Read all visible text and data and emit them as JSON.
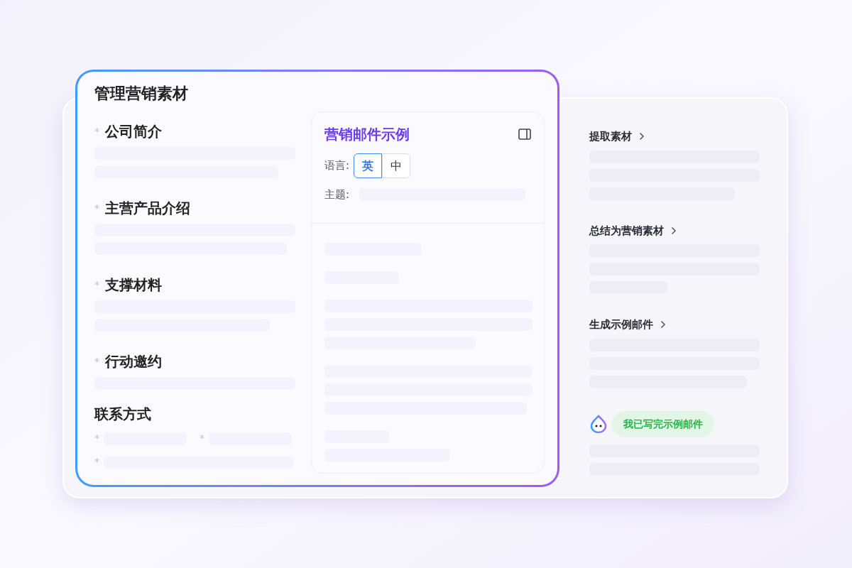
{
  "editor": {
    "title": "管理营销素材",
    "fields": [
      {
        "label": "公司简介",
        "marker": "*"
      },
      {
        "label": "主营产品介绍",
        "marker": "*"
      },
      {
        "label": "支撑材料",
        "marker": "*"
      },
      {
        "label": "行动邀约",
        "marker": "*"
      }
    ],
    "contact": {
      "label": "联系方式",
      "fields": [
        {
          "marker": "*"
        },
        {
          "marker": "*"
        },
        {
          "marker": "*"
        }
      ]
    }
  },
  "email_panel": {
    "title": "营销邮件示例",
    "language_label": "语言:",
    "languages": [
      {
        "label": "英",
        "selected": true
      },
      {
        "label": "中",
        "selected": false
      }
    ],
    "subject_label": "主题:"
  },
  "steps": [
    {
      "title": "提取素材"
    },
    {
      "title": "总结为营销素材"
    },
    {
      "title": "生成示例邮件"
    }
  ],
  "message": {
    "text": "我已写完示例邮件"
  }
}
